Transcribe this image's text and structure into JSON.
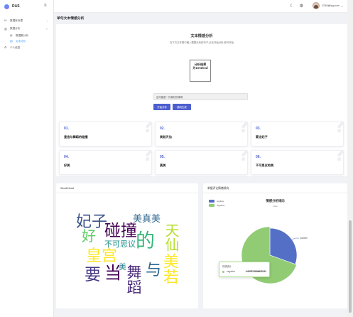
{
  "app": {
    "name": "DAS"
  },
  "sidebar": {
    "items": [
      {
        "label": "数据库处理",
        "icon": "database-icon"
      },
      {
        "label": "数据分析",
        "icon": "chart-icon"
      },
      {
        "label": "数据集分析",
        "icon": "dataset-icon"
      },
      {
        "label": "文本分析",
        "icon": "text-icon"
      },
      {
        "label": "个人信息",
        "icon": "user-icon"
      }
    ]
  },
  "header": {
    "user_email": "1216@qq.com",
    "icons": [
      "theme-toggle-icon",
      "settings-icon"
    ]
  },
  "page": {
    "title": "单句文本情感分析"
  },
  "analysis": {
    "title": "文本情感分析",
    "subtitle": "在下方文本框中输入需要分析的句子,点击开始分析,即可开始",
    "result_line1": "分析结果",
    "result_line2": "为neutral",
    "input_placeholder": "这可能是一件美好的事情",
    "start_button": "开始分析",
    "random_button": "随机生成"
  },
  "result_cards": [
    {
      "num": "01.",
      "label": "皇宫与舞蹈的碰撞"
    },
    {
      "num": "02.",
      "label": "美若天仙"
    },
    {
      "num": "03.",
      "label": "要当妃子"
    },
    {
      "num": "04.",
      "label": "好美"
    },
    {
      "num": "05.",
      "label": "真美"
    },
    {
      "num": "06.",
      "label": "不可思议的美"
    }
  ],
  "wordcloud": {
    "title": "WordCloud",
    "words": [
      {
        "text": "妃子",
        "color": "#3b528b"
      },
      {
        "text": "美真美",
        "color": "#31688e"
      },
      {
        "text": "好",
        "color": "#5ec962"
      },
      {
        "text": "碰撞",
        "color": "#440154"
      },
      {
        "text": "不可思议",
        "color": "#21918c"
      },
      {
        "text": "的",
        "color": "#35b779"
      },
      {
        "text": "天仙",
        "color": "#b5de2b"
      },
      {
        "text": "美若",
        "color": "#fde725"
      },
      {
        "text": "皇宫",
        "color": "#fde725"
      },
      {
        "text": "当",
        "color": "#440154"
      },
      {
        "text": "美",
        "color": "#26828e"
      },
      {
        "text": "舞蹈",
        "color": "#482878"
      },
      {
        "text": "与",
        "color": "#31688e"
      },
      {
        "text": "要",
        "color": "#443983"
      }
    ]
  },
  "pie_card": {
    "header": "单据评论情绪倾向",
    "tooltip_title": "情感统计",
    "tooltip_label": "negative",
    "tooltip_value": "0.695574896605191"
  },
  "chart_data": {
    "type": "pie",
    "title": "情感分析倾向",
    "subtitle": "Data",
    "legend_position": "top-left",
    "slices": [
      {
        "name": "positive",
        "value": 0.304425103394809,
        "color": "#5470c6"
      },
      {
        "name": "negative",
        "value": 0.695574896605191,
        "color": "#91cc75"
      }
    ]
  }
}
